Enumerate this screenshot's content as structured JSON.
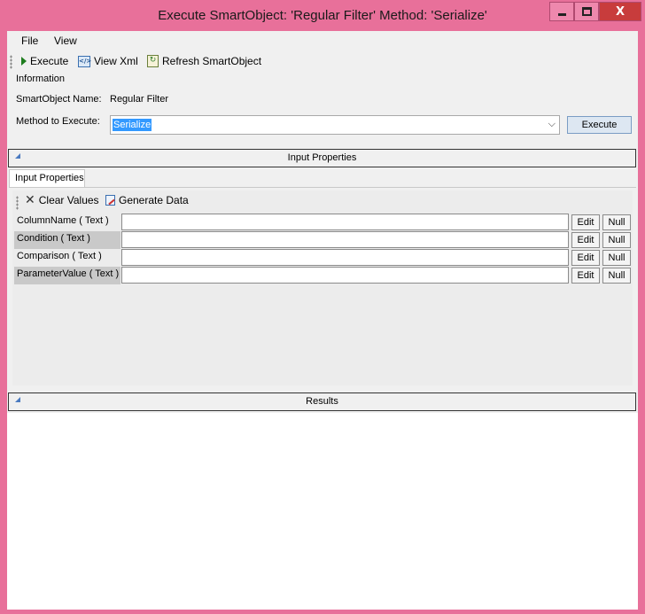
{
  "window": {
    "title": "Execute SmartObject: 'Regular Filter' Method: 'Serialize'",
    "close_glyph": "X"
  },
  "menu": {
    "items": [
      "File",
      "View"
    ]
  },
  "toolbar": {
    "execute_label": "Execute",
    "view_xml_label": "View Xml",
    "refresh_label": "Refresh SmartObject",
    "xml_icon_glyph": "</>"
  },
  "information": {
    "group_label": "Information",
    "smartobject_name_label": "SmartObject Name:",
    "smartobject_name_value": "Regular Filter",
    "method_label": "Method to Execute:",
    "method_value": "Serialize",
    "execute_button": "Execute"
  },
  "input_section": {
    "header": "Input Properties",
    "tab_label": "Input Properties",
    "clear_values_label": "Clear Values",
    "generate_data_label": "Generate Data",
    "rows": [
      {
        "label": "ColumnName ( Text )",
        "value": "",
        "edit": "Edit",
        "null": "Null"
      },
      {
        "label": "Condition ( Text )",
        "value": "",
        "edit": "Edit",
        "null": "Null"
      },
      {
        "label": "Comparison ( Text )",
        "value": "",
        "edit": "Edit",
        "null": "Null"
      },
      {
        "label": "ParameterValue ( Text )",
        "value": "",
        "edit": "Edit",
        "null": "Null"
      }
    ]
  },
  "results_section": {
    "header": "Results"
  },
  "colors": {
    "window_frame": "#e8709a",
    "selection": "#3399ff",
    "close_button": "#c83c3c"
  }
}
